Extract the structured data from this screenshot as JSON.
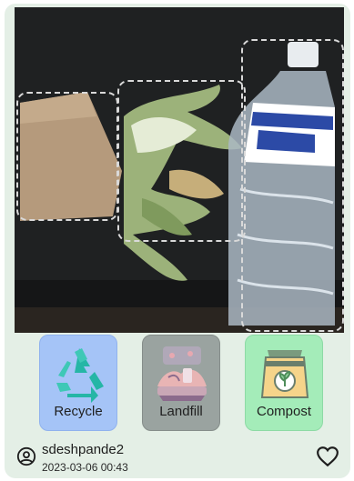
{
  "post": {
    "photo_description_icon": "waste-photo",
    "detections": [
      {
        "label": "paper"
      },
      {
        "label": "corn-husk"
      },
      {
        "label": "plastic-bottle"
      }
    ]
  },
  "bins": [
    {
      "label": "Recycle",
      "icon": "recycle-icon",
      "color": "#a5c4f7"
    },
    {
      "label": "Landfill",
      "icon": "landfill-icon",
      "color": "#9aa3a0"
    },
    {
      "label": "Compost",
      "icon": "compost-icon",
      "color": "#a4ecb9"
    }
  ],
  "footer": {
    "username": "sdeshpande2",
    "timestamp": "2023-03-06 00:43",
    "avatar_icon": "user-circle-icon",
    "like_icon": "heart-outline-icon"
  },
  "colors": {
    "card_background": "#e4efe6",
    "recycle": "#a5c4f7",
    "landfill": "#9aa3a0",
    "compost": "#a4ecb9"
  }
}
